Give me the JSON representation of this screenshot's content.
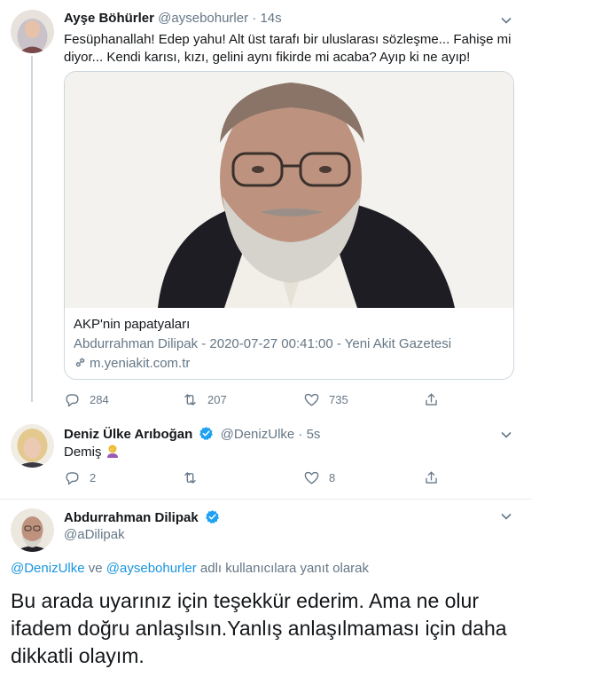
{
  "tweet1": {
    "name": "Ayşe Böhürler",
    "handle": "@aysebohurler",
    "dot": "·",
    "time": "14s",
    "text_line1": "Fesüphanallah! Edep yahu! Alt üst tarafı bir uluslarası sözleşme... Fahişe mi",
    "text_line2": "diyor... Kendi karısı, kızı, gelini aynı fikirde mi acaba? Ayıp ki ne ayıp!",
    "card": {
      "title": "AKP'nin papatyaları",
      "description": "Abdurrahman Dilipak - 2020-07-27 00:41:00 - Yeni Akit Gazetesi",
      "domain": "m.yeniakit.com.tr"
    },
    "stats": {
      "replies": "284",
      "retweets": "207",
      "likes": "735"
    }
  },
  "tweet2": {
    "name": "Deniz Ülke Arıboğan",
    "handle": "@DenizUlke",
    "dot": "·",
    "time": "5s",
    "text": "Demiş",
    "stats": {
      "replies": "2",
      "retweets": "",
      "likes": "8"
    }
  },
  "tweet3": {
    "name": "Abdurrahman Dilipak",
    "handle": "@aDilipak",
    "reply_mention1": "@DenizUlke",
    "reply_and": " ve ",
    "reply_mention2": "@aysebohurler",
    "reply_suffix": " adlı kullanıcılara yanıt olarak",
    "text": "Bu arada uyarınız için teşekkür ederim. Ama ne olur ifadem doğru anlaşılsın.Yanlış anlaşılmaması için daha dikkatli olayım."
  },
  "colors": {
    "accent": "#1da1f2",
    "mention": "#1b95e0",
    "secondary": "#657786",
    "border": "#e6ecf0"
  },
  "icons": [
    "reply-icon",
    "retweet-icon",
    "like-icon",
    "share-icon",
    "verified-icon",
    "caret-down-icon",
    "link-icon",
    "facepalm-emoji"
  ]
}
